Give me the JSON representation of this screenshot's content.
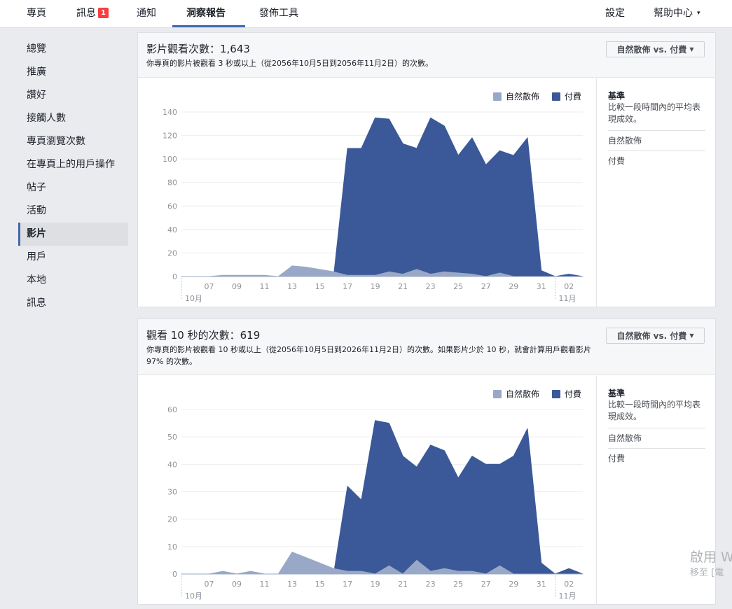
{
  "nav": {
    "items": [
      {
        "label": "專頁"
      },
      {
        "label": "訊息",
        "badge": "1"
      },
      {
        "label": "通知"
      },
      {
        "label": "洞察報告"
      },
      {
        "label": "發佈工具"
      }
    ],
    "settings": "設定",
    "help": "幫助中心",
    "help_caret": "▾"
  },
  "sidebar": {
    "items": [
      {
        "label": "總覽"
      },
      {
        "label": "推廣"
      },
      {
        "label": "讚好"
      },
      {
        "label": "接觸人數"
      },
      {
        "label": "專頁瀏覽次數"
      },
      {
        "label": "在專頁上的用戶操作"
      },
      {
        "label": "帖子"
      },
      {
        "label": "活動"
      },
      {
        "label": "影片"
      },
      {
        "label": "用戶"
      },
      {
        "label": "本地"
      },
      {
        "label": "訊息"
      }
    ],
    "active_index": 8
  },
  "panels": [
    {
      "title": "影片觀看次數：1,643",
      "desc": "你專頁的影片被觀看 3 秒或以上（從2056年10月5日到2056年11月2日）的次數。",
      "dropdown": "自然散佈 vs. 付費",
      "legend": {
        "organic": "自然散佈",
        "paid": "付費"
      },
      "benchmark": {
        "title": "基準",
        "desc": "比較一段時間內的平均表現成效。",
        "row1": "自然散佈",
        "row2": "付費"
      }
    },
    {
      "title": "觀看 10 秒的次數：619",
      "desc": "你專頁的影片被觀看 10 秒或以上（從2056年10月5日到2026年11月2日）的次數。如果影片少於 10 秒，就會計算用戶觀看影片 97% 的次數。",
      "dropdown": "自然散佈 vs. 付費",
      "legend": {
        "organic": "自然散佈",
        "paid": "付費"
      },
      "benchmark": {
        "title": "基準",
        "desc": "比較一段時間內的平均表現成效。",
        "row1": "自然散佈",
        "row2": "付費"
      }
    }
  ],
  "colors": {
    "organic": "#9aa8c7",
    "paid": "#3b5998",
    "accent": "#4267b2",
    "badge": "#fa3e3e"
  },
  "chart_data": [
    {
      "type": "area",
      "x_labels": [
        "07",
        "09",
        "11",
        "13",
        "15",
        "17",
        "19",
        "21",
        "23",
        "25",
        "27",
        "29",
        "31",
        "02"
      ],
      "month_labels": [
        "10月",
        "11月"
      ],
      "x_days": [
        5,
        6,
        7,
        8,
        9,
        10,
        11,
        12,
        13,
        14,
        15,
        16,
        17,
        18,
        19,
        20,
        21,
        22,
        23,
        24,
        25,
        26,
        27,
        28,
        29,
        30,
        31,
        32,
        33,
        34
      ],
      "ylim": [
        0,
        140
      ],
      "yticks": [
        0,
        20,
        40,
        60,
        80,
        100,
        120,
        140
      ],
      "series": [
        {
          "name": "付費",
          "values": [
            0,
            0,
            0,
            0,
            0,
            0,
            0,
            0,
            0,
            0,
            0,
            0,
            109,
            109,
            135,
            134,
            113,
            109,
            135,
            128,
            103,
            118,
            95,
            107,
            103,
            118,
            5,
            0,
            2,
            0
          ]
        },
        {
          "name": "自然散佈",
          "values": [
            0,
            0,
            0,
            1,
            1,
            1,
            1,
            0,
            9,
            8,
            6,
            4,
            1,
            1,
            1,
            4,
            2,
            6,
            2,
            4,
            3,
            2,
            0,
            3,
            0,
            0,
            0,
            0,
            0,
            0
          ]
        }
      ]
    },
    {
      "type": "area",
      "x_labels": [
        "07",
        "09",
        "11",
        "13",
        "15",
        "17",
        "19",
        "21",
        "23",
        "25",
        "27",
        "29",
        "31",
        "02"
      ],
      "month_labels": [
        "10月",
        "11月"
      ],
      "x_days": [
        5,
        6,
        7,
        8,
        9,
        10,
        11,
        12,
        13,
        14,
        15,
        16,
        17,
        18,
        19,
        20,
        21,
        22,
        23,
        24,
        25,
        26,
        27,
        28,
        29,
        30,
        31,
        32,
        33,
        34
      ],
      "ylim": [
        0,
        60
      ],
      "yticks": [
        0,
        10,
        20,
        30,
        40,
        50,
        60
      ],
      "series": [
        {
          "name": "付費",
          "values": [
            0,
            0,
            0,
            0,
            0,
            0,
            0,
            0,
            0,
            0,
            0,
            0,
            32,
            27,
            56,
            55,
            43,
            39,
            47,
            45,
            35,
            43,
            40,
            40,
            43,
            53,
            4,
            0,
            2,
            0
          ]
        },
        {
          "name": "自然散佈",
          "values": [
            0,
            0,
            0,
            1,
            0,
            1,
            0,
            0,
            8,
            6,
            4,
            2,
            1,
            1,
            0,
            3,
            0,
            5,
            1,
            2,
            1,
            1,
            0,
            3,
            0,
            0,
            0,
            0,
            0,
            0
          ]
        }
      ]
    }
  ],
  "watermark": {
    "line1": "啟用 W",
    "line2": "移至 [電"
  }
}
